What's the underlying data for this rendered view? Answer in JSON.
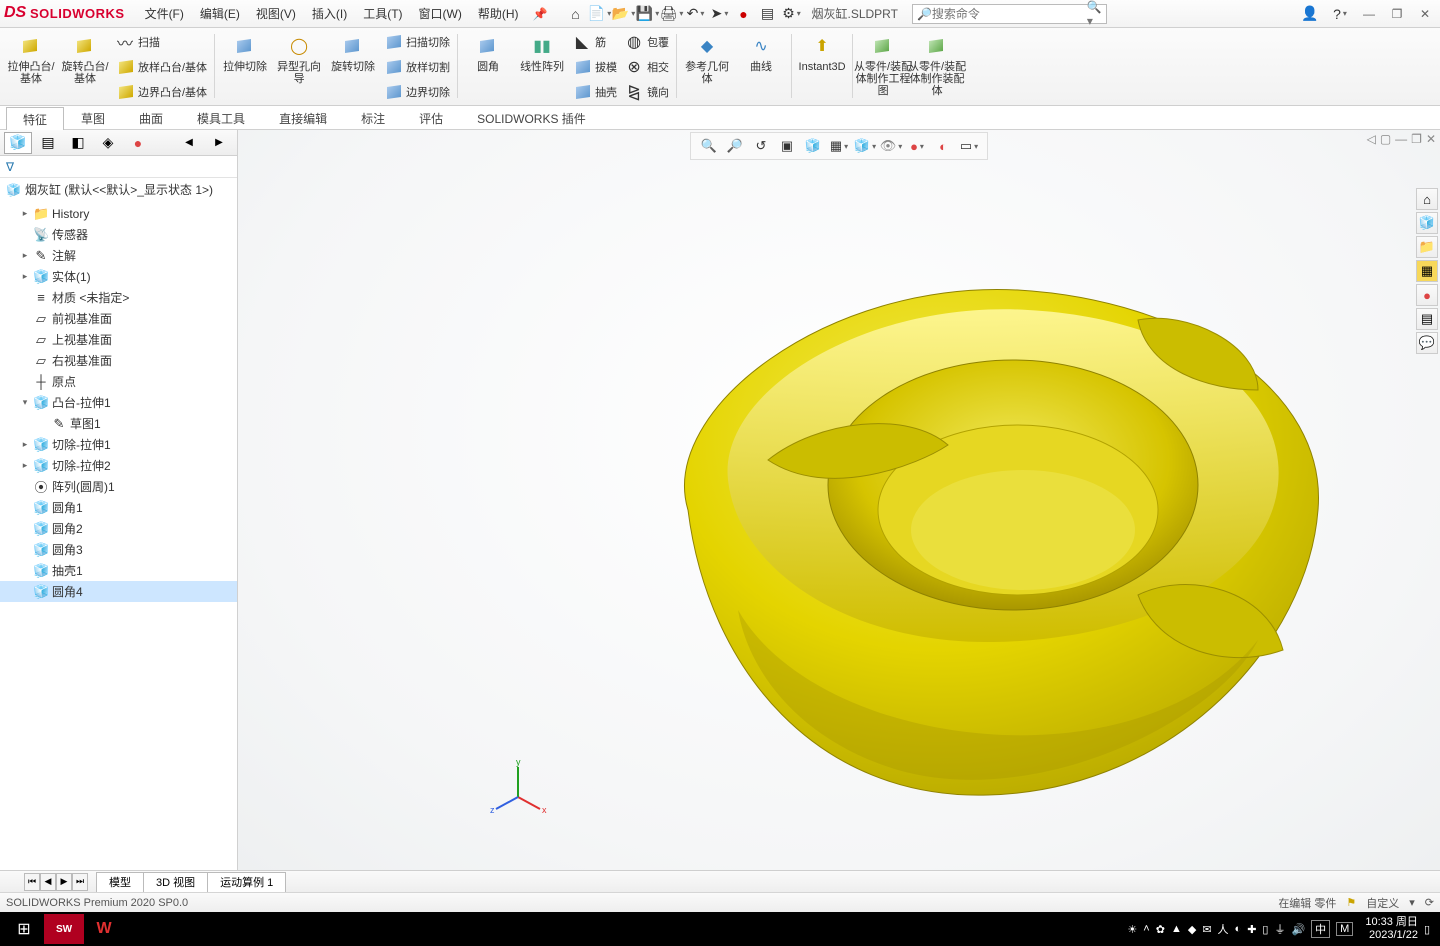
{
  "brand": "SOLIDWORKS",
  "menus": [
    "文件(F)",
    "编辑(E)",
    "视图(V)",
    "插入(I)",
    "工具(T)",
    "窗口(W)",
    "帮助(H)"
  ],
  "file_tab": "烟灰缸.SLDPRT",
  "search_placeholder": "搜索命令",
  "ribbon": {
    "extrudeBoss": "拉伸凸台/基体",
    "revolveBoss": "旋转凸台/基体",
    "sweep": "扫描",
    "loftBoss": "放样凸台/基体",
    "boundaryBoss": "边界凸台/基体",
    "extrudeCut": "拉伸切除",
    "holeWizard": "异型孔向导",
    "revolveCut": "旋转切除",
    "sweepCut": "扫描切除",
    "loftCut": "放样切割",
    "boundaryCut": "边界切除",
    "fillet": "圆角",
    "linearPattern": "线性阵列",
    "rib": "筋",
    "draft": "拔模",
    "shell": "抽壳",
    "wrap": "包覆",
    "intersect": "相交",
    "mirror": "镜向",
    "refGeom": "参考几何体",
    "curves": "曲线",
    "instant3d": "Instant3D",
    "fromPartDrawing": "从零件/装配体制作工程图",
    "fromPartAssembly": "从零件/装配体制作装配体"
  },
  "ribbon_tabs": [
    "特征",
    "草图",
    "曲面",
    "模具工具",
    "直接编辑",
    "标注",
    "评估",
    "SOLIDWORKS 插件"
  ],
  "tree": {
    "root": "烟灰缸  (默认<<默认>_显示状态 1>)",
    "nodes": [
      {
        "label": "History",
        "depth": 1,
        "tw": "▸",
        "icon": "folder"
      },
      {
        "label": "传感器",
        "depth": 1,
        "tw": "",
        "icon": "sensor"
      },
      {
        "label": "注解",
        "depth": 1,
        "tw": "▸",
        "icon": "note"
      },
      {
        "label": "实体(1)",
        "depth": 1,
        "tw": "▸",
        "icon": "solid"
      },
      {
        "label": "材质 <未指定>",
        "depth": 1,
        "tw": "",
        "icon": "material"
      },
      {
        "label": "前视基准面",
        "depth": 1,
        "tw": "",
        "icon": "plane"
      },
      {
        "label": "上视基准面",
        "depth": 1,
        "tw": "",
        "icon": "plane"
      },
      {
        "label": "右视基准面",
        "depth": 1,
        "tw": "",
        "icon": "plane"
      },
      {
        "label": "原点",
        "depth": 1,
        "tw": "",
        "icon": "origin"
      },
      {
        "label": "凸台-拉伸1",
        "depth": 1,
        "tw": "▾",
        "icon": "extrude"
      },
      {
        "label": "草图1",
        "depth": 2,
        "tw": "",
        "icon": "sketch"
      },
      {
        "label": "切除-拉伸1",
        "depth": 1,
        "tw": "▸",
        "icon": "cut"
      },
      {
        "label": "切除-拉伸2",
        "depth": 1,
        "tw": "▸",
        "icon": "cut"
      },
      {
        "label": "阵列(圆周)1",
        "depth": 1,
        "tw": "",
        "icon": "pattern"
      },
      {
        "label": "圆角1",
        "depth": 1,
        "tw": "",
        "icon": "fillet"
      },
      {
        "label": "圆角2",
        "depth": 1,
        "tw": "",
        "icon": "fillet"
      },
      {
        "label": "圆角3",
        "depth": 1,
        "tw": "",
        "icon": "fillet"
      },
      {
        "label": "抽壳1",
        "depth": 1,
        "tw": "",
        "icon": "shell"
      },
      {
        "label": "圆角4",
        "depth": 1,
        "tw": "",
        "icon": "fillet",
        "sel": true
      }
    ]
  },
  "triad": {
    "x": "x",
    "y": "y",
    "z": "z"
  },
  "bottom_tabs": [
    "模型",
    "3D 视图",
    "运动算例 1"
  ],
  "status_left": "SOLIDWORKS Premium 2020 SP0.0",
  "status_right": {
    "editing": "在编辑 零件",
    "custom": "自定义"
  },
  "taskbar": {
    "time": "10:33 周日",
    "date": "2023/1/22",
    "ime1": "中",
    "ime2": "M"
  }
}
